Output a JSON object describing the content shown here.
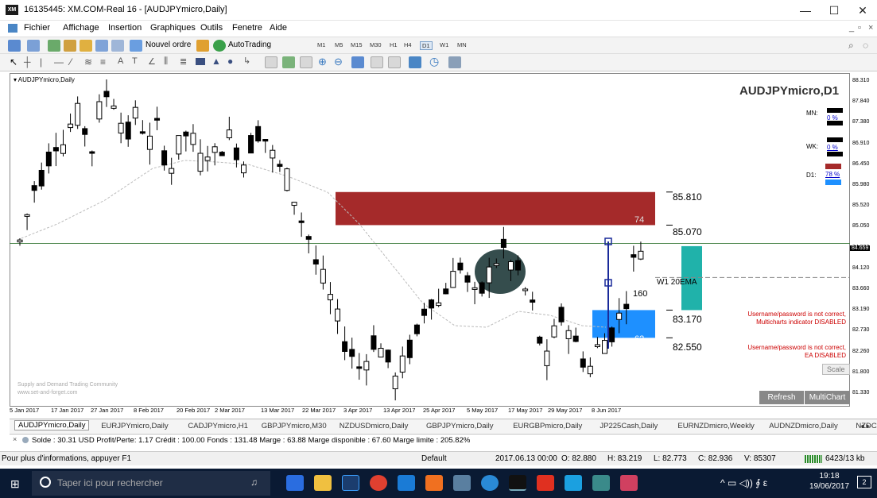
{
  "window": {
    "title": "16135445: XM.COM-Real 16 - [AUDJPYmicro,Daily]",
    "app_badge": "XM",
    "minimize": "—",
    "maximize": "☐",
    "close": "✕"
  },
  "menu": [
    "Fichier",
    "Affichage",
    "Insertion",
    "Graphiques",
    "Outils",
    "Fenetre",
    "Aide"
  ],
  "toolbar": {
    "new_order": "Nouvel ordre",
    "autotrading": "AutoTrading",
    "timeframes": [
      "M1",
      "M5",
      "M15",
      "M30",
      "H1",
      "H4",
      "D1",
      "W1",
      "MN"
    ]
  },
  "chart": {
    "symbol_label": "AUDJPYmicro,Daily",
    "panel_title": "AUDJPYmicro,D1",
    "panel_rows": [
      {
        "label": "MN:",
        "value": "0 %",
        "color": "#000000"
      },
      {
        "label": "WK:",
        "value": "0 %",
        "color": "#000000"
      },
      {
        "label": "D1:",
        "value": "78 %",
        "color": "#a52a2a"
      }
    ],
    "levels": [
      "85.810",
      "85.070",
      "83.170",
      "82.550"
    ],
    "supply_zone": {
      "label": "74",
      "color": "#a52a2a"
    },
    "demand_zone": {
      "label": "62",
      "color": "#1e90ff"
    },
    "ema_label": "W1 20EMA",
    "distance_label": "160",
    "warning1": [
      "Username/password is not correct,",
      "Multicharts indicator DISABLED"
    ],
    "warning2": [
      "Username/password is not correct,",
      "EA DISABLED"
    ],
    "scale_button": "Scale",
    "refresh_button": "Refresh",
    "multichart_button": "MultiChart",
    "watermark": [
      "Supply and Demand Trading Community",
      "www.set-and-forget.com"
    ],
    "current_price": "84.659",
    "price_ticks": [
      "88.310",
      "87.840",
      "87.380",
      "86.910",
      "86.450",
      "85.980",
      "85.520",
      "85.050",
      "84.590",
      "84.120",
      "83.660",
      "83.190",
      "82.730",
      "82.260",
      "81.800",
      "81.330"
    ],
    "time_ticks": [
      "5 Jan 2017",
      "17 Jan 2017",
      "27 Jan 2017",
      "8 Feb 2017",
      "20 Feb 2017",
      "2 Mar 2017",
      "13 Mar 2017",
      "22 Mar 2017",
      "3 Apr 2017",
      "13 Apr 2017",
      "25 Apr 2017",
      "5 May 2017",
      "17 May 2017",
      "29 May 2017",
      "8 Jun 2017"
    ]
  },
  "chart_tabs": [
    "AUDJPYmicro,Daily",
    "EURJPYmicro,Daily",
    "CADJPYmicro,H1",
    "GBPJPYmicro,M30",
    "NZDUSDmicro,Daily",
    "GBPJPYmicro,Daily",
    "EURGBPmicro,Daily",
    "JP225Cash,Daily",
    "EURNZDmicro,Weekly",
    "AUDNZDmicro,Daily",
    "NZDCADn"
  ],
  "account": "Solde : 30.31 USD  Profit/Perte: 1.17  Crédit : 100.00  Fonds : 131.48  Marge : 63.88  Marge disponible : 67.60  Marge limite : 205.82%",
  "status": {
    "help": "Pour plus d'informations, appuyer F1",
    "profile": "Default",
    "time": "2017.06.13 00:00",
    "open": "O: 82.880",
    "high": "H: 83.219",
    "low": "L: 82.773",
    "close": "C: 82.936",
    "volume": "V: 85307",
    "traffic": "6423/13 kb"
  },
  "taskbar": {
    "search": "Taper ici pour rechercher",
    "clock_time": "19:18",
    "clock_date": "19/06/2017",
    "notif": "2"
  }
}
